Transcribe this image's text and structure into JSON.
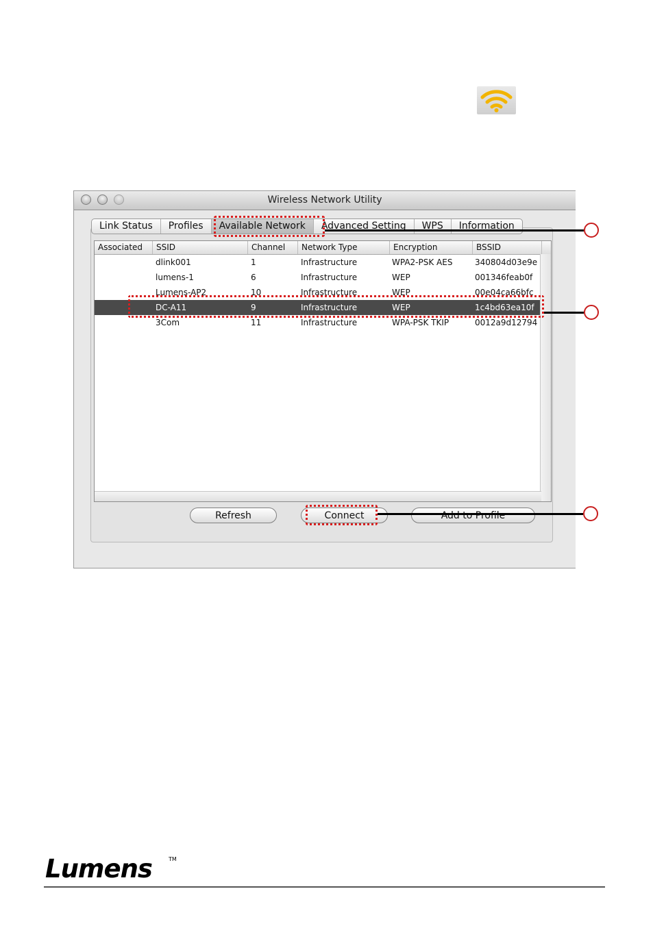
{
  "window": {
    "title": "Wireless Network Utility"
  },
  "tabs": [
    {
      "label": "Link Status",
      "active": false
    },
    {
      "label": "Profiles",
      "active": false
    },
    {
      "label": "Available Network",
      "active": true
    },
    {
      "label": "Advanced Setting",
      "active": false
    },
    {
      "label": "WPS",
      "active": false
    },
    {
      "label": "Information",
      "active": false
    }
  ],
  "table": {
    "columns": [
      "Associated",
      "SSID",
      "Channel",
      "Network Type",
      "Encryption",
      "BSSID"
    ],
    "rows": [
      {
        "associated": "",
        "ssid": "dlink001",
        "channel": "1",
        "type": "Infrastructure",
        "encryption": "WPA2-PSK AES",
        "bssid": "340804d03e9e",
        "selected": false
      },
      {
        "associated": "",
        "ssid": "lumens-1",
        "channel": "6",
        "type": "Infrastructure",
        "encryption": "WEP",
        "bssid": "001346feab0f",
        "selected": false
      },
      {
        "associated": "",
        "ssid": "Lumens-AP2",
        "channel": "10",
        "type": "Infrastructure",
        "encryption": "WEP",
        "bssid": "00e04ca66bfc",
        "selected": false
      },
      {
        "associated": "",
        "ssid": "DC-A11",
        "channel": "9",
        "type": "Infrastructure",
        "encryption": "WEP",
        "bssid": "1c4bd63ea10f",
        "selected": true
      },
      {
        "associated": "",
        "ssid": "3Com",
        "channel": "11",
        "type": "Infrastructure",
        "encryption": "WPA-PSK TKIP",
        "bssid": "0012a9d12794",
        "selected": false
      }
    ]
  },
  "buttons": {
    "refresh": "Refresh",
    "connect": "Connect",
    "add_to_profile": "Add to Profile"
  },
  "icons": {
    "tray": "wifi-signal-icon"
  },
  "colors": {
    "highlight": "#d81e1e",
    "selected_row": "#4a4a4a",
    "wifi": "#f2b400"
  },
  "footer": {
    "logo_text": "Lumens",
    "tm": "TM"
  }
}
